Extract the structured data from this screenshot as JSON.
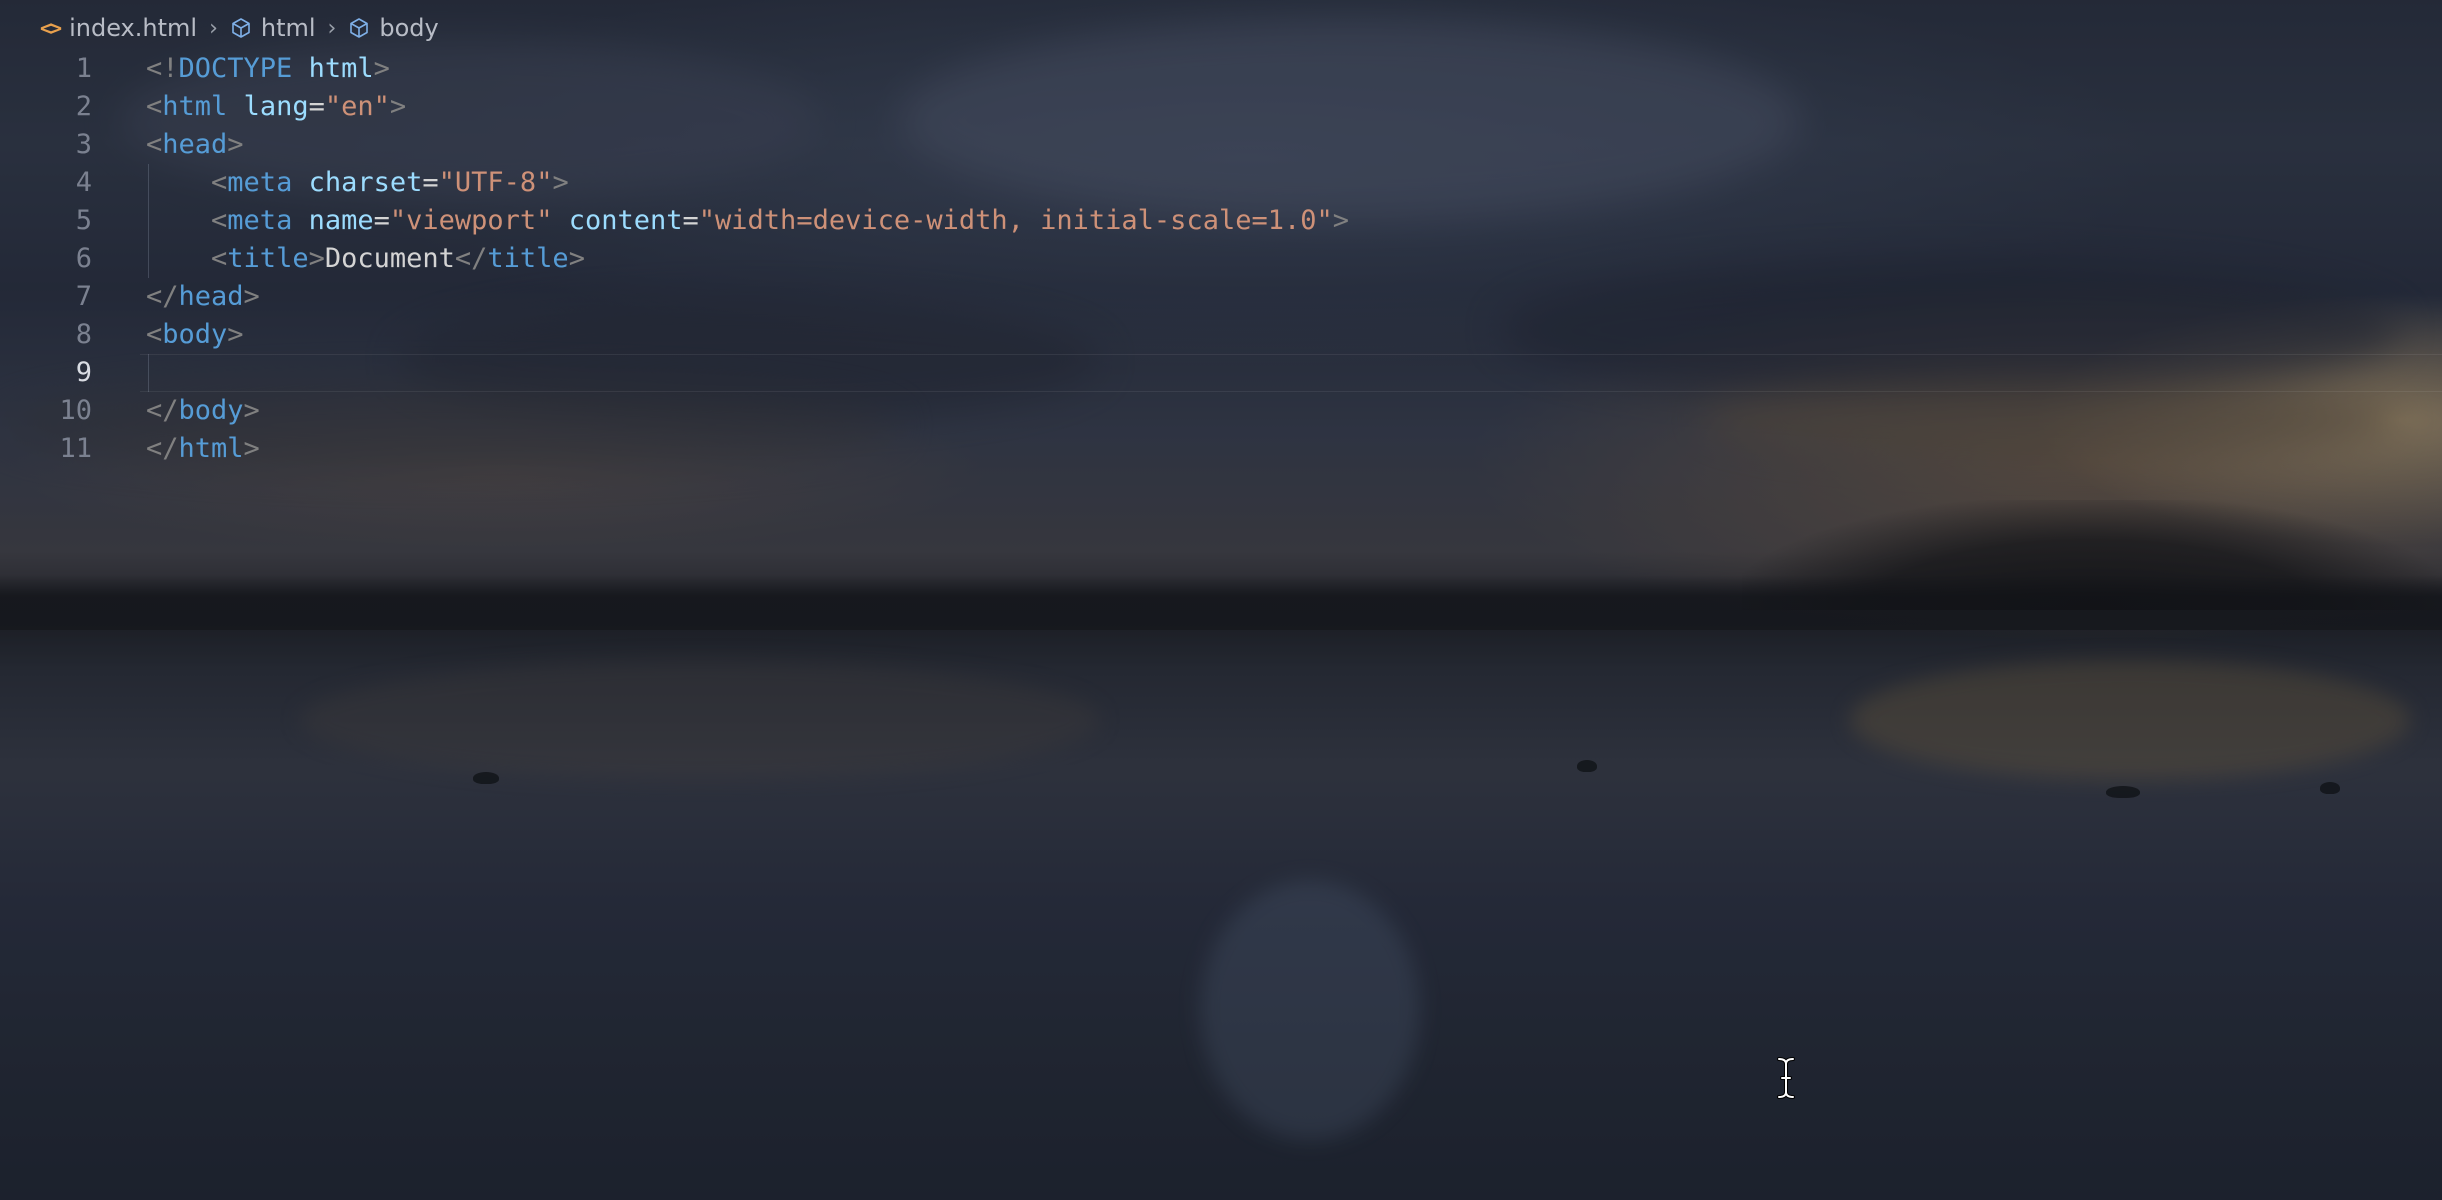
{
  "breadcrumb": {
    "items": [
      {
        "label": "index.html",
        "icon": "html-file-icon"
      },
      {
        "label": "html",
        "icon": "cube-icon"
      },
      {
        "label": "body",
        "icon": "cube-icon"
      }
    ],
    "separator_icon": "chevron-right-icon"
  },
  "editor": {
    "language": "html",
    "current_line": 9,
    "lines": [
      {
        "number": "1",
        "tokens": [
          {
            "type": "bracket",
            "text": "<!"
          },
          {
            "type": "tag",
            "text": "DOCTYPE"
          },
          {
            "type": "text",
            "text": " "
          },
          {
            "type": "attr",
            "text": "html"
          },
          {
            "type": "bracket",
            "text": ">"
          }
        ]
      },
      {
        "number": "2",
        "tokens": [
          {
            "type": "bracket",
            "text": "<"
          },
          {
            "type": "tag",
            "text": "html"
          },
          {
            "type": "text",
            "text": " "
          },
          {
            "type": "attr",
            "text": "lang"
          },
          {
            "type": "eq",
            "text": "="
          },
          {
            "type": "str",
            "text": "\"en\""
          },
          {
            "type": "bracket",
            "text": ">"
          }
        ]
      },
      {
        "number": "3",
        "tokens": [
          {
            "type": "bracket",
            "text": "<"
          },
          {
            "type": "tag",
            "text": "head"
          },
          {
            "type": "bracket",
            "text": ">"
          }
        ]
      },
      {
        "number": "4",
        "indent": true,
        "tokens": [
          {
            "type": "text",
            "text": "    "
          },
          {
            "type": "bracket",
            "text": "<"
          },
          {
            "type": "tag",
            "text": "meta"
          },
          {
            "type": "text",
            "text": " "
          },
          {
            "type": "attr",
            "text": "charset"
          },
          {
            "type": "eq",
            "text": "="
          },
          {
            "type": "str",
            "text": "\"UTF-8\""
          },
          {
            "type": "bracket",
            "text": ">"
          }
        ]
      },
      {
        "number": "5",
        "indent": true,
        "tokens": [
          {
            "type": "text",
            "text": "    "
          },
          {
            "type": "bracket",
            "text": "<"
          },
          {
            "type": "tag",
            "text": "meta"
          },
          {
            "type": "text",
            "text": " "
          },
          {
            "type": "attr",
            "text": "name"
          },
          {
            "type": "eq",
            "text": "="
          },
          {
            "type": "str",
            "text": "\"viewport\""
          },
          {
            "type": "text",
            "text": " "
          },
          {
            "type": "attr",
            "text": "content"
          },
          {
            "type": "eq",
            "text": "="
          },
          {
            "type": "str",
            "text": "\"width=device-width, initial-scale=1.0\""
          },
          {
            "type": "bracket",
            "text": ">"
          }
        ]
      },
      {
        "number": "6",
        "indent": true,
        "tokens": [
          {
            "type": "text",
            "text": "    "
          },
          {
            "type": "bracket",
            "text": "<"
          },
          {
            "type": "tag",
            "text": "title"
          },
          {
            "type": "bracket",
            "text": ">"
          },
          {
            "type": "text",
            "text": "Document"
          },
          {
            "type": "bracket",
            "text": "</"
          },
          {
            "type": "tag",
            "text": "title"
          },
          {
            "type": "bracket",
            "text": ">"
          }
        ]
      },
      {
        "number": "7",
        "tokens": [
          {
            "type": "bracket",
            "text": "</"
          },
          {
            "type": "tag",
            "text": "head"
          },
          {
            "type": "bracket",
            "text": ">"
          }
        ]
      },
      {
        "number": "8",
        "tokens": [
          {
            "type": "bracket",
            "text": "<"
          },
          {
            "type": "tag",
            "text": "body"
          },
          {
            "type": "bracket",
            "text": ">"
          }
        ]
      },
      {
        "number": "9",
        "indent": true,
        "tokens": []
      },
      {
        "number": "10",
        "tokens": [
          {
            "type": "bracket",
            "text": "</"
          },
          {
            "type": "tag",
            "text": "body"
          },
          {
            "type": "bracket",
            "text": ">"
          }
        ]
      },
      {
        "number": "11",
        "tokens": [
          {
            "type": "bracket",
            "text": "</"
          },
          {
            "type": "tag",
            "text": "html"
          },
          {
            "type": "bracket",
            "text": ">"
          }
        ]
      }
    ]
  },
  "theme": {
    "tag_color": "#569cd6",
    "attr_color": "#9cdcfe",
    "string_color": "#ce9178",
    "bracket_color": "#808080",
    "text_color": "#d4d4d4",
    "line_number_color": "#7b8190"
  },
  "mouse_cursor_icon": "text-ibeam-icon"
}
